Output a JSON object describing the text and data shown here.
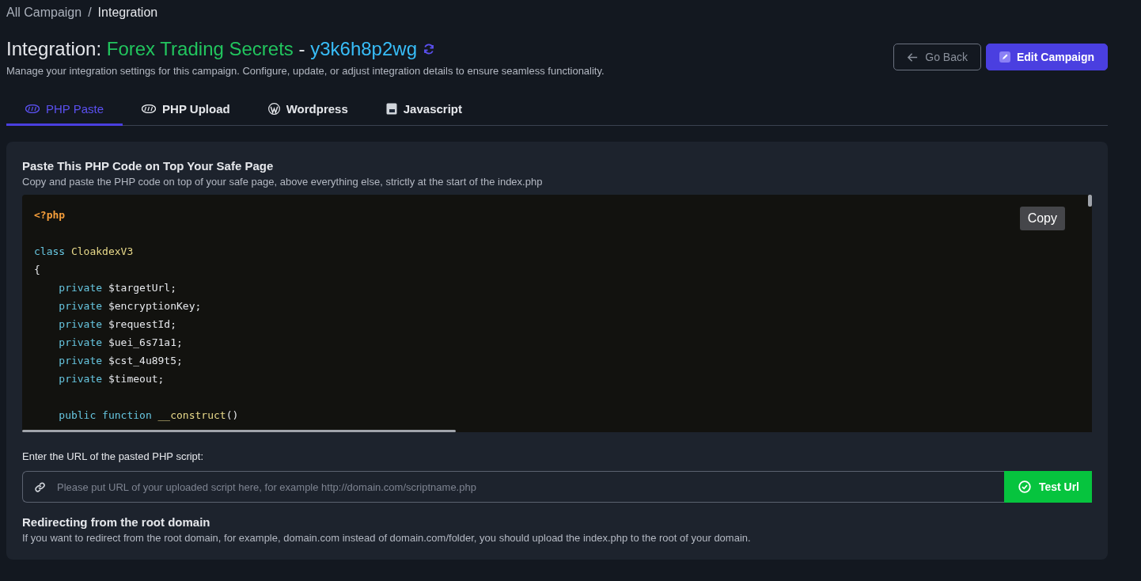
{
  "breadcrumb": [
    {
      "label": "All Campaign",
      "current": false
    },
    {
      "label": "Integration",
      "current": true
    }
  ],
  "breadcrumb_separator": "/",
  "header": {
    "prefix": "Integration:",
    "campaign": "Forex Trading Secrets",
    "dash": "-",
    "code": "y3k6h8p2wg",
    "description": "Manage your integration settings for this campaign. Configure, update, or adjust integration details to ensure seamless functionality."
  },
  "buttons": [
    {
      "kind": "back",
      "label": "Go Back"
    },
    {
      "kind": "edit",
      "label": "Edit Campaign"
    }
  ],
  "tabs": [
    {
      "kind": "php",
      "label": "PHP Paste",
      "selected": true
    },
    {
      "kind": "php",
      "label": "PHP Upload",
      "selected": false
    },
    {
      "kind": "wordpress",
      "label": "Wordpress",
      "selected": false
    },
    {
      "kind": "js",
      "label": "Javascript",
      "selected": false
    }
  ],
  "panel": {
    "title": "Paste This PHP Code on Top Your Safe Page",
    "subtitle": "Copy and paste the PHP code on top of your safe page, above everything else, strictly at the start of the index.php",
    "copy_label": "Copy",
    "code": [
      {
        "kind": "code",
        "tokens": [
          {
            "kind": "tag",
            "text": "<?php"
          }
        ]
      },
      {
        "kind": "blank"
      },
      {
        "kind": "code",
        "tokens": [
          {
            "kind": "keyword",
            "text": "class "
          },
          {
            "kind": "name",
            "text": "CloakdexV3"
          }
        ]
      },
      {
        "kind": "code",
        "tokens": [
          {
            "kind": "plain",
            "text": "{"
          }
        ]
      },
      {
        "kind": "code",
        "tokens": [
          {
            "kind": "keyword",
            "text": "    private "
          },
          {
            "kind": "plain",
            "text": "$targetUrl;"
          }
        ]
      },
      {
        "kind": "code",
        "tokens": [
          {
            "kind": "keyword",
            "text": "    private "
          },
          {
            "kind": "plain",
            "text": "$encryptionKey;"
          }
        ]
      },
      {
        "kind": "code",
        "tokens": [
          {
            "kind": "keyword",
            "text": "    private "
          },
          {
            "kind": "plain",
            "text": "$requestId;"
          }
        ]
      },
      {
        "kind": "code",
        "tokens": [
          {
            "kind": "keyword",
            "text": "    private "
          },
          {
            "kind": "plain",
            "text": "$uei_6s71a1;"
          }
        ]
      },
      {
        "kind": "code",
        "tokens": [
          {
            "kind": "keyword",
            "text": "    private "
          },
          {
            "kind": "plain",
            "text": "$cst_4u89t5;"
          }
        ]
      },
      {
        "kind": "code",
        "tokens": [
          {
            "kind": "keyword",
            "text": "    private "
          },
          {
            "kind": "plain",
            "text": "$timeout;"
          }
        ]
      },
      {
        "kind": "blank"
      },
      {
        "kind": "code",
        "tokens": [
          {
            "kind": "keyword",
            "text": "    public function "
          },
          {
            "kind": "name",
            "text": "__construct"
          },
          {
            "kind": "plain",
            "text": "()"
          }
        ]
      }
    ],
    "url_label": "Enter the URL of the pasted PHP script:",
    "url_placeholder": "Please put URL of your uploaded script here, for example http://domain.com/scriptname.php",
    "test_label": "Test Url",
    "redirect_title": "Redirecting from the root domain",
    "redirect_text": "If you want to redirect from the root domain, for example, domain.com instead of domain.com/folder, you should upload the index.php to the root of your domain."
  }
}
